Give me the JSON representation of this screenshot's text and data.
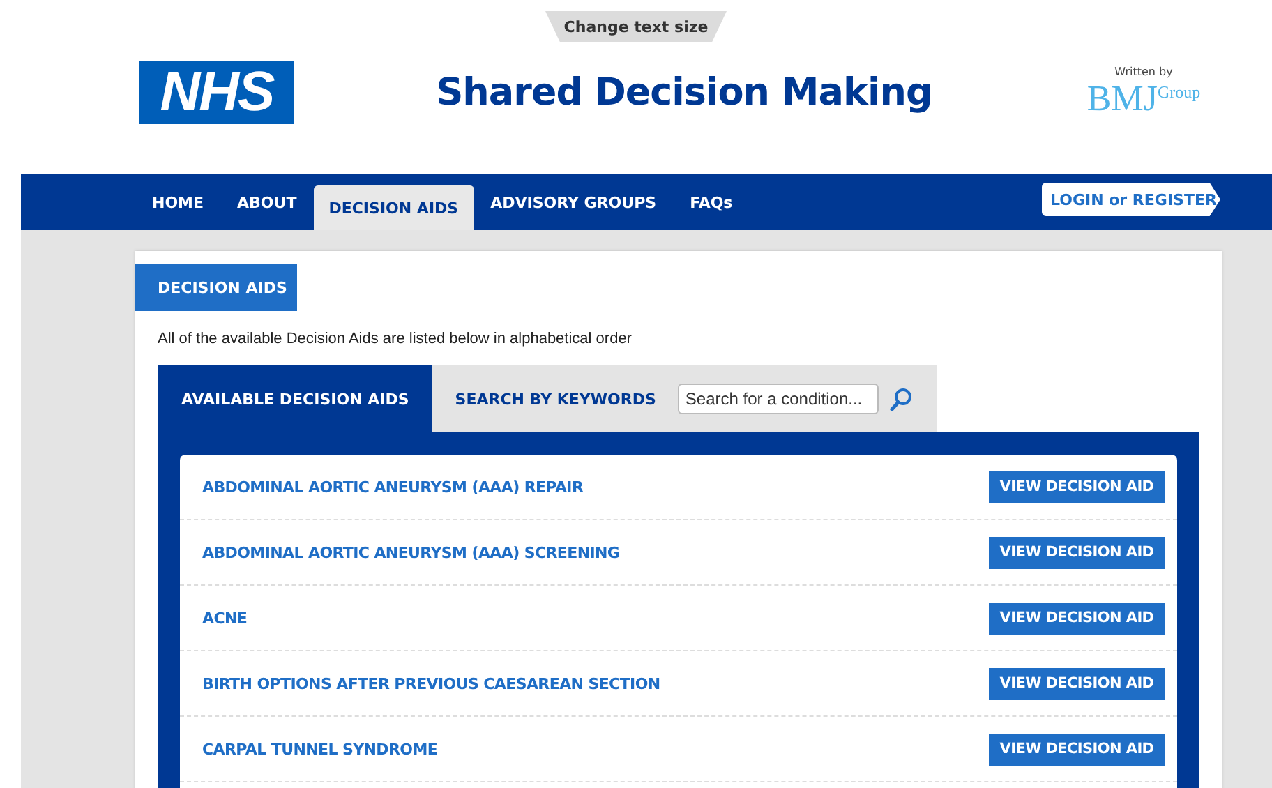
{
  "header": {
    "text_size_button": "Change text size",
    "logo": "NHS",
    "title": "Shared Decision Making",
    "credit": {
      "written_by": "Written by",
      "brand": "BMJ",
      "brand_suffix": "Group"
    }
  },
  "nav": {
    "items": [
      {
        "label": "HOME",
        "selected": false
      },
      {
        "label": "ABOUT",
        "selected": false
      },
      {
        "label": "DECISION AIDS",
        "selected": true
      },
      {
        "label": "ADVISORY GROUPS",
        "selected": false
      },
      {
        "label": "FAQs",
        "selected": false
      }
    ],
    "login": "LOGIN or REGISTER"
  },
  "section": {
    "heading": "DECISION AIDS",
    "intro": "All of the available Decision Aids are listed below in alphabetical order",
    "tabs": [
      {
        "label": "AVAILABLE DECISION AIDS",
        "selected": true
      },
      {
        "label": "SEARCH BY KEYWORDS",
        "selected": false
      }
    ],
    "search": {
      "placeholder": "Search for a condition..."
    },
    "rows": [
      {
        "name": "ABDOMINAL AORTIC ANEURYSM (AAA) REPAIR",
        "button": "VIEW DECISION AID"
      },
      {
        "name": "ABDOMINAL AORTIC ANEURYSM (AAA) SCREENING",
        "button": "VIEW DECISION AID"
      },
      {
        "name": "ACNE",
        "button": "VIEW DECISION AID"
      },
      {
        "name": "BIRTH OPTIONS AFTER PREVIOUS CAESAREAN SECTION",
        "button": "VIEW DECISION AID"
      },
      {
        "name": "CARPAL TUNNEL SYNDROME",
        "button": "VIEW DECISION AID"
      }
    ]
  }
}
